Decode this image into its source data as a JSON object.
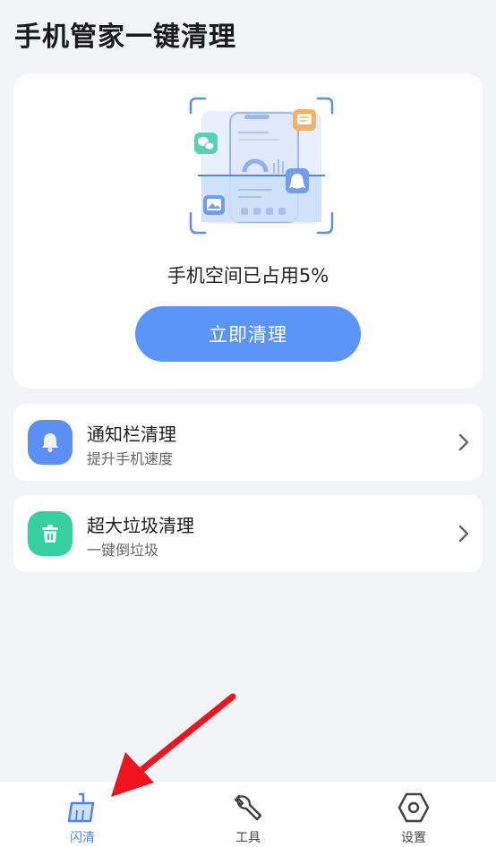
{
  "header": {
    "title": "手机管家一键清理"
  },
  "hero": {
    "usage_text": "手机空间已占用5%",
    "clean_button_label": "立即清理"
  },
  "features": [
    {
      "title": "通知栏清理",
      "subtitle": "提升手机速度",
      "icon": "bell-icon",
      "color": "#5c8ff5"
    },
    {
      "title": "超大垃圾清理",
      "subtitle": "一键倒垃圾",
      "icon": "trash-icon",
      "color": "#35cfa0"
    }
  ],
  "bottom_nav": [
    {
      "label": "闪清",
      "icon": "broom-icon",
      "active": true
    },
    {
      "label": "工具",
      "icon": "wrench-icon",
      "active": false
    },
    {
      "label": "设置",
      "icon": "hexagon-gear-icon",
      "active": false
    }
  ],
  "colors": {
    "accent": "#5b95f7",
    "active_nav": "#4d86f2",
    "arrow": "#f0141e"
  }
}
